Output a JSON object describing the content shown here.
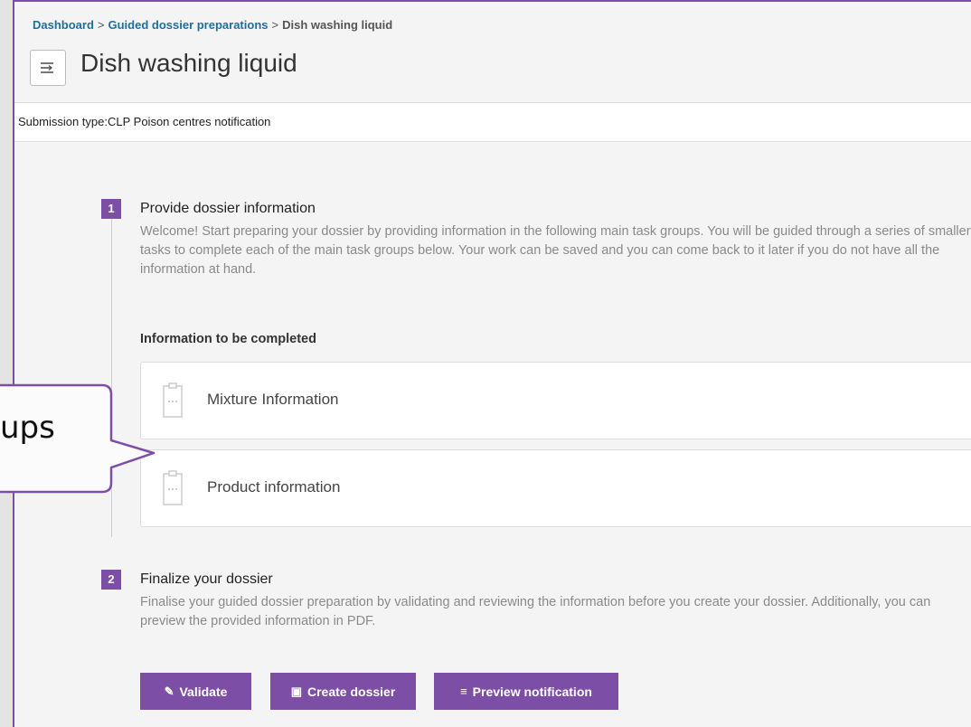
{
  "breadcrumb": {
    "items": [
      "Dashboard",
      "Guided dossier preparations"
    ],
    "separator": ">",
    "current": "Dish washing liquid"
  },
  "header": {
    "title": "Dish washing liquid",
    "menu_icon": "menu-toggle-icon"
  },
  "submission": {
    "text": "Submission type:CLP Poison centres notification"
  },
  "step1": {
    "number": "1",
    "title": "Provide dossier information",
    "description": "Welcome! Start preparing your dossier by providing information in the following main task groups. You will be guided through a series of smaller tasks to complete each of the main task groups below. Your work can be saved and you can come back to it later if you do not have all the information at hand.",
    "subheading": "Information to be completed",
    "tasks": [
      {
        "label": "Mixture Information",
        "icon": "clipboard-icon"
      },
      {
        "label": "Product information",
        "icon": "clipboard-icon"
      }
    ]
  },
  "step2": {
    "number": "2",
    "title": "Finalize your dossier",
    "description": "Finalise your guided dossier preparation by validating and reviewing the information before you create your dossier. Additionally, you can preview the provided information in PDF.",
    "buttons": [
      {
        "label": "Validate",
        "icon": "broom-icon",
        "glyph": "✎"
      },
      {
        "label": "Create dossier",
        "icon": "save-icon",
        "glyph": "▣"
      },
      {
        "label": "Preview notification",
        "icon": "document-icon",
        "glyph": "≡"
      }
    ]
  },
  "callout": {
    "text": "ups"
  },
  "colors": {
    "accent": "#7d4ea6",
    "link": "#1f6e9a",
    "muted": "#8a8a8a"
  }
}
